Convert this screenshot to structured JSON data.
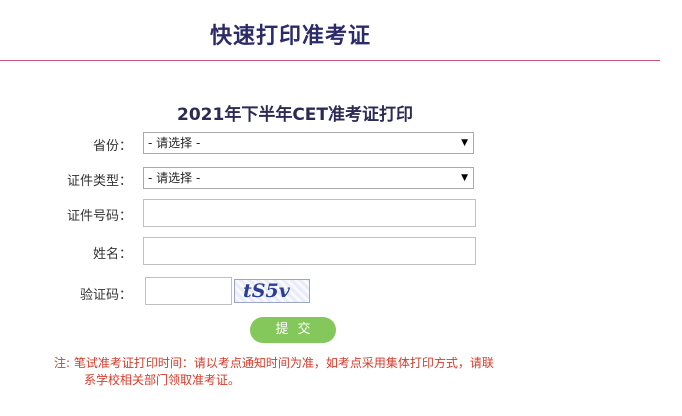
{
  "header": {
    "title": "快速打印准考证"
  },
  "form": {
    "title": "2021年下半年CET准考证打印",
    "province_label": "省份：",
    "province_value": "- 请选择 -",
    "id_type_label": "证件类型：",
    "id_type_value": "- 请选择 -",
    "id_number_label": "证件号码：",
    "name_label": "姓名：",
    "captcha_label": "验证码：",
    "captcha_text": "tS5v",
    "submit_label": "提交"
  },
  "note": {
    "line1": "注:  笔试准考证打印时间：请以考点通知时间为准，如考点采用集体打印方式，请联",
    "line2": "系学校相关部门领取准考证。"
  },
  "colors": {
    "accent_rule": "#c8577c",
    "button": "#84c75a",
    "note_text": "#d63b2b"
  }
}
